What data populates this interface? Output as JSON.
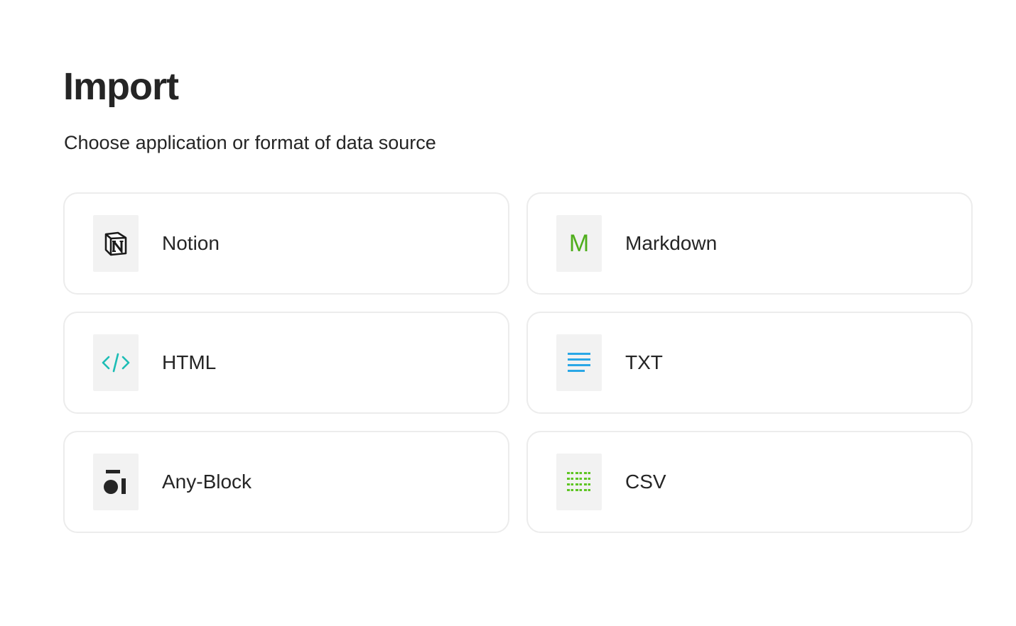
{
  "header": {
    "title": "Import",
    "subtitle": "Choose application or format of data source"
  },
  "sources": [
    {
      "id": "notion",
      "label": "Notion",
      "icon": "notion-icon"
    },
    {
      "id": "markdown",
      "label": "Markdown",
      "icon": "markdown-icon",
      "icon_glyph": "M",
      "icon_color": "#4fae1c"
    },
    {
      "id": "html",
      "label": "HTML",
      "icon": "code-icon",
      "icon_color": "#1dbdb5"
    },
    {
      "id": "txt",
      "label": "TXT",
      "icon": "text-lines-icon",
      "icon_color": "#2aa7e6"
    },
    {
      "id": "any-block",
      "label": "Any-Block",
      "icon": "anytype-icon",
      "icon_color": "#252525"
    },
    {
      "id": "csv",
      "label": "CSV",
      "icon": "table-grid-icon",
      "icon_color": "#5ec524"
    }
  ]
}
